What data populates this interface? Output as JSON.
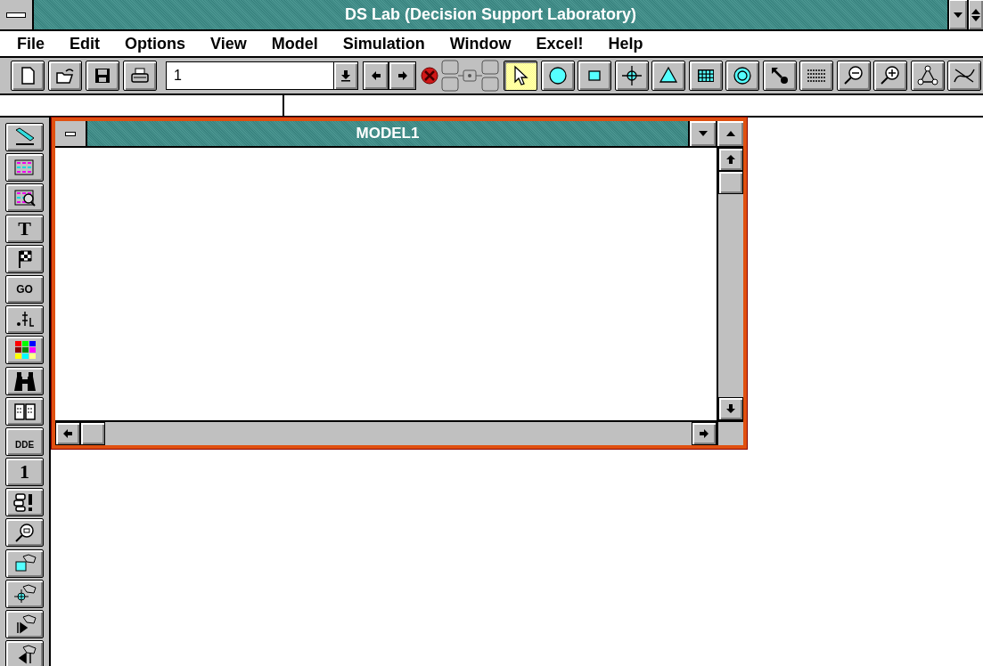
{
  "window": {
    "title": "DS Lab (Decision Support Laboratory)"
  },
  "menu": [
    {
      "label": "File"
    },
    {
      "label": "Edit"
    },
    {
      "label": "Options"
    },
    {
      "label": "View"
    },
    {
      "label": "Model"
    },
    {
      "label": "Simulation"
    },
    {
      "label": "Window"
    },
    {
      "label": "Excel!"
    },
    {
      "label": "Help"
    }
  ],
  "toolbar": {
    "file_buttons": [
      {
        "kind": "new"
      },
      {
        "kind": "open"
      },
      {
        "kind": "save"
      },
      {
        "kind": "print"
      }
    ],
    "page_field": {
      "value": "1"
    },
    "nav_buttons": [
      {
        "kind": "prev"
      },
      {
        "kind": "next"
      }
    ],
    "tools": [
      {
        "kind": "pointer",
        "selected": true
      },
      {
        "kind": "circle",
        "selected": false
      },
      {
        "kind": "square",
        "selected": false
      },
      {
        "kind": "crosshair",
        "selected": false
      },
      {
        "kind": "triangle",
        "selected": false
      },
      {
        "kind": "grid",
        "selected": false
      },
      {
        "kind": "target",
        "selected": false
      },
      {
        "kind": "arrow-dot",
        "selected": false
      },
      {
        "kind": "lines",
        "selected": false
      },
      {
        "kind": "zoom-out",
        "selected": false
      },
      {
        "kind": "zoom-in",
        "selected": false
      },
      {
        "kind": "graph",
        "selected": false
      },
      {
        "kind": "curve",
        "selected": false
      }
    ]
  },
  "side_tools": [
    {
      "kind": "pencil"
    },
    {
      "kind": "table"
    },
    {
      "kind": "table-search"
    },
    {
      "kind": "text",
      "text": "T"
    },
    {
      "kind": "flag"
    },
    {
      "kind": "go",
      "text": "GO"
    },
    {
      "kind": "units"
    },
    {
      "kind": "palette"
    },
    {
      "kind": "binoculars"
    },
    {
      "kind": "book"
    },
    {
      "kind": "dde",
      "text": "DDE"
    },
    {
      "kind": "number",
      "text": "1"
    },
    {
      "kind": "alert"
    },
    {
      "kind": "inspect"
    },
    {
      "kind": "hand-square"
    },
    {
      "kind": "hand-cross"
    },
    {
      "kind": "hand-right"
    },
    {
      "kind": "hand-left"
    }
  ],
  "child_window": {
    "title": "MODEL1"
  }
}
